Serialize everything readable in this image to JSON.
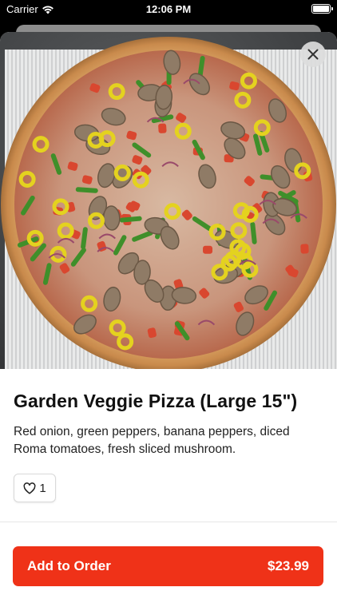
{
  "status_bar": {
    "carrier": "Carrier",
    "time": "12:06 PM"
  },
  "item": {
    "title": "Garden Veggie Pizza (Large 15\")",
    "description": "Red onion, green peppers, banana peppers, diced Roma tomatoes, fresh sliced mushroom.",
    "like_count": "1",
    "image_icon": "pizza-photo"
  },
  "order": {
    "add_label": "Add to Order",
    "price": "$23.99"
  },
  "colors": {
    "accent": "#ef3218",
    "text": "#111111"
  }
}
